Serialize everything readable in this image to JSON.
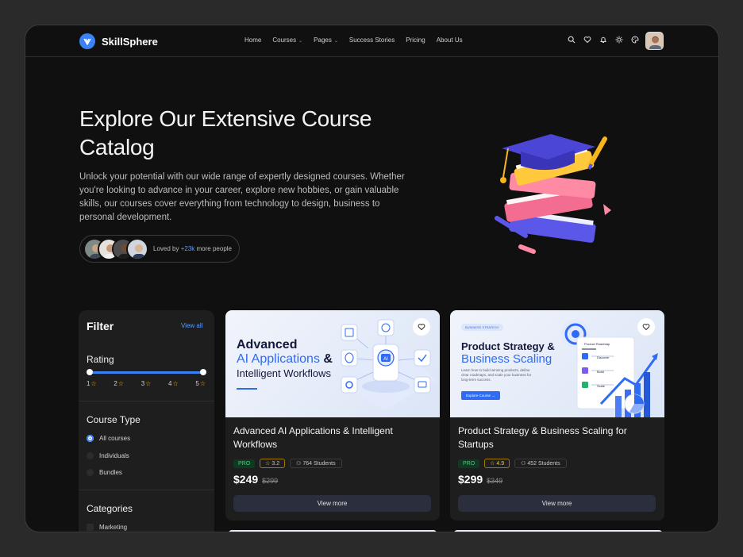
{
  "nav": {
    "brand": "SkillSphere",
    "links": [
      {
        "label": "Home",
        "dropdown": false
      },
      {
        "label": "Courses",
        "dropdown": true
      },
      {
        "label": "Pages",
        "dropdown": true
      },
      {
        "label": "Success Stories",
        "dropdown": false
      },
      {
        "label": "Pricing",
        "dropdown": false
      },
      {
        "label": "About Us",
        "dropdown": false
      }
    ],
    "icons": [
      "search-icon",
      "heart-icon",
      "bell-icon",
      "sun-icon",
      "palette-icon"
    ]
  },
  "hero": {
    "title": "Explore Our Extensive Course Catalog",
    "description": "Unlock your potential with our wide range of expertly designed courses. Whether you're looking to advance in your career, explore new hobbies, or gain valuable skills, our courses cover everything from technology to design, business to personal development.",
    "loved_prefix": "Loved by",
    "loved_count": "+23k",
    "loved_suffix": "more people"
  },
  "filter": {
    "title": "Filter",
    "view_all": "View all",
    "rating": {
      "label": "Rating",
      "ticks": [
        "1",
        "2",
        "3",
        "4",
        "5"
      ],
      "range": [
        1,
        5
      ]
    },
    "course_type": {
      "label": "Course Type",
      "options": [
        {
          "label": "All courses",
          "selected": true
        },
        {
          "label": "Individuals",
          "selected": false
        },
        {
          "label": "Bundles",
          "selected": false
        }
      ]
    },
    "categories": {
      "label": "Categories",
      "options": [
        {
          "label": "Marketing",
          "checked": false
        }
      ]
    }
  },
  "courses": [
    {
      "img_line1": "Advanced",
      "img_line2": "AI Applications",
      "img_amp": " &",
      "img_line3": "Intelligent Workflows",
      "title": "Advanced AI Applications & Intelligent Workflows",
      "badge": "PRO",
      "rating": "3.2",
      "students": "764 Students",
      "price": "$249",
      "old_price": "$299",
      "button": "View more"
    },
    {
      "img_tag": "BUSINESS STRATEGY",
      "img_line1": "Product Strategy &",
      "img_line2": "Business Scaling",
      "img_sub": "Learn how to build winning products, define clear roadmaps, and scale your business for long-term success.",
      "img_cta": "Explore Course →",
      "img_panel": "Product Roadmap",
      "img_items": [
        "Discover",
        "Build",
        "Scale"
      ],
      "title": "Product Strategy & Business Scaling for Startups",
      "badge": "PRO",
      "rating": "4.9",
      "students": "452 Students",
      "price": "$299",
      "old_price": "$349",
      "button": "View more"
    }
  ],
  "colors": {
    "accent": "#3b82f6",
    "background": "#101010",
    "card": "#1e1e1e",
    "star": "#f5b301"
  }
}
